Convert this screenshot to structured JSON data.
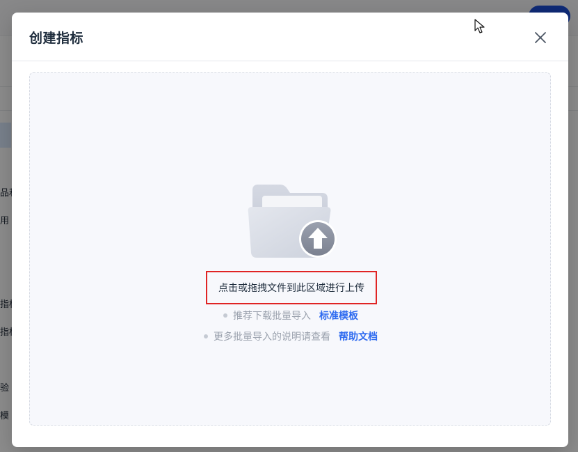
{
  "background": {
    "sidebar_fragments": [
      "品利",
      "用",
      "指标",
      "指标",
      "验",
      "模"
    ]
  },
  "modal": {
    "title": "创建指标",
    "close_icon": "close-icon"
  },
  "upload": {
    "icon": "folder-upload-icon",
    "hint": "点击或拖拽文件到此区域进行上传",
    "tip1_text": "推荐下载批量导入",
    "tip1_link": "标准模板",
    "tip2_text": "更多批量导入的说明请查看",
    "tip2_link": "帮助文档"
  },
  "colors": {
    "accent": "#2f6bf0",
    "highlight_box": "#e02424"
  }
}
